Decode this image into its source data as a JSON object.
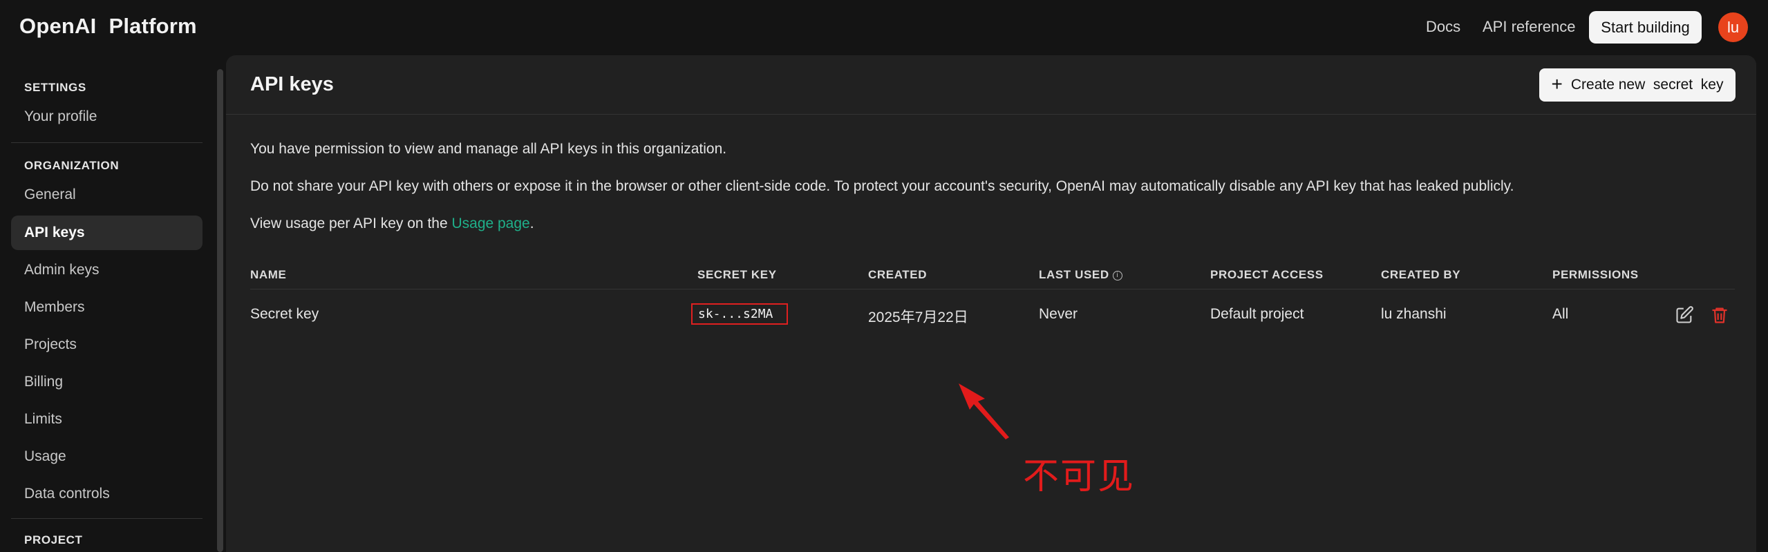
{
  "header": {
    "brand_name": "OpenAI",
    "brand_product": "Platform",
    "links": [
      "Docs",
      "API reference"
    ],
    "start_button": "Start building",
    "avatar_initials": "lu",
    "avatar_color": "#e8431c"
  },
  "sidebar": {
    "sections": [
      {
        "title": "SETTINGS",
        "items": [
          "Your profile"
        ]
      },
      {
        "title": "ORGANIZATION",
        "items": [
          "General",
          "API keys",
          "Admin keys",
          "Members",
          "Projects",
          "Billing",
          "Limits",
          "Usage",
          "Data controls"
        ]
      },
      {
        "title": "PROJECT",
        "items": []
      }
    ],
    "active_item": "API keys"
  },
  "main": {
    "title": "API keys",
    "create_button": "Create new  secret  key",
    "para1": "You have permission to view and manage all API keys in this organization.",
    "para2": "Do not share your API key with others or expose it in the browser or other client-side code. To protect your account's security, OpenAI may automatically disable any API key that has leaked publicly.",
    "para3_prefix": "View usage per API key on the ",
    "para3_link": "Usage page",
    "para3_suffix": ".",
    "columns": [
      "NAME",
      "SECRET KEY",
      "CREATED",
      "LAST USED",
      "PROJECT ACCESS",
      "CREATED BY",
      "PERMISSIONS"
    ],
    "rows": [
      {
        "name": "Secret key",
        "secret_key": "sk-...s2MA",
        "created": "2025年7月22日",
        "last_used": "Never",
        "project_access": "Default project",
        "created_by": "lu zhanshi",
        "permissions": "All"
      }
    ]
  },
  "annotation": {
    "text": "不可见",
    "color": "#e21b1b"
  },
  "colors": {
    "link": "#1fb08a",
    "danger": "#e0322a",
    "panel": "#212121",
    "background": "#141414"
  }
}
